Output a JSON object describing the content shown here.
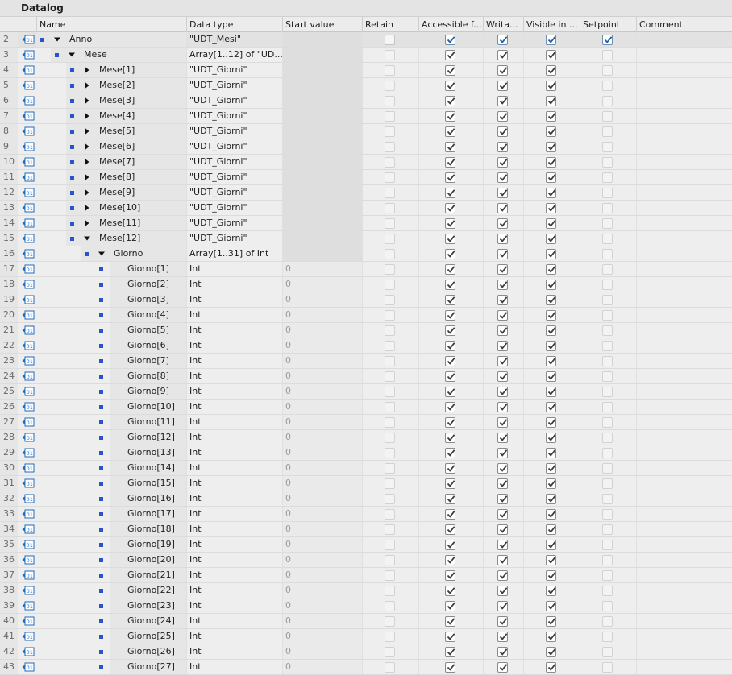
{
  "window": {
    "title": "Datalog"
  },
  "columns": [
    "Name",
    "Data type",
    "Start value",
    "Retain",
    "Accessible f...",
    "Writa...",
    "Visible in ...",
    "Setpoint",
    "Comment"
  ],
  "icons": {
    "row_icon": "db-element-icon",
    "bullet": "blue-square-icon",
    "expanded": "triangle-down-icon",
    "collapsed": "triangle-right-icon"
  },
  "colors": {
    "bullet": "#2b53c8",
    "icon": "#1c6cbf",
    "check_blue": "#1f5fa0"
  },
  "rows": [
    {
      "num": "2",
      "name": "Anno",
      "type": "\"UDT_Mesi\"",
      "start": "",
      "level": 0,
      "toggle": "expanded",
      "checks": [
        0,
        2,
        2,
        2,
        2
      ]
    },
    {
      "num": "3",
      "name": "Mese",
      "type": "Array[1..12] of \"UD...",
      "start": "",
      "level": 1,
      "toggle": "expanded",
      "checks": [
        3,
        1,
        1,
        1,
        3
      ]
    },
    {
      "num": "4",
      "name": "Mese[1]",
      "type": "\"UDT_Giorni\"",
      "start": "",
      "level": 2,
      "toggle": "collapsed",
      "checks": [
        3,
        1,
        1,
        1,
        3
      ]
    },
    {
      "num": "5",
      "name": "Mese[2]",
      "type": "\"UDT_Giorni\"",
      "start": "",
      "level": 2,
      "toggle": "collapsed",
      "checks": [
        3,
        1,
        1,
        1,
        3
      ]
    },
    {
      "num": "6",
      "name": "Mese[3]",
      "type": "\"UDT_Giorni\"",
      "start": "",
      "level": 2,
      "toggle": "collapsed",
      "checks": [
        3,
        1,
        1,
        1,
        3
      ]
    },
    {
      "num": "7",
      "name": "Mese[4]",
      "type": "\"UDT_Giorni\"",
      "start": "",
      "level": 2,
      "toggle": "collapsed",
      "checks": [
        3,
        1,
        1,
        1,
        3
      ]
    },
    {
      "num": "8",
      "name": "Mese[5]",
      "type": "\"UDT_Giorni\"",
      "start": "",
      "level": 2,
      "toggle": "collapsed",
      "checks": [
        3,
        1,
        1,
        1,
        3
      ]
    },
    {
      "num": "9",
      "name": "Mese[6]",
      "type": "\"UDT_Giorni\"",
      "start": "",
      "level": 2,
      "toggle": "collapsed",
      "checks": [
        3,
        1,
        1,
        1,
        3
      ]
    },
    {
      "num": "10",
      "name": "Mese[7]",
      "type": "\"UDT_Giorni\"",
      "start": "",
      "level": 2,
      "toggle": "collapsed",
      "checks": [
        3,
        1,
        1,
        1,
        3
      ]
    },
    {
      "num": "11",
      "name": "Mese[8]",
      "type": "\"UDT_Giorni\"",
      "start": "",
      "level": 2,
      "toggle": "collapsed",
      "checks": [
        3,
        1,
        1,
        1,
        3
      ]
    },
    {
      "num": "12",
      "name": "Mese[9]",
      "type": "\"UDT_Giorni\"",
      "start": "",
      "level": 2,
      "toggle": "collapsed",
      "checks": [
        3,
        1,
        1,
        1,
        3
      ]
    },
    {
      "num": "13",
      "name": "Mese[10]",
      "type": "\"UDT_Giorni\"",
      "start": "",
      "level": 2,
      "toggle": "collapsed",
      "checks": [
        3,
        1,
        1,
        1,
        3
      ]
    },
    {
      "num": "14",
      "name": "Mese[11]",
      "type": "\"UDT_Giorni\"",
      "start": "",
      "level": 2,
      "toggle": "collapsed",
      "checks": [
        3,
        1,
        1,
        1,
        3
      ]
    },
    {
      "num": "15",
      "name": "Mese[12]",
      "type": "\"UDT_Giorni\"",
      "start": "",
      "level": 2,
      "toggle": "expanded",
      "checks": [
        3,
        1,
        1,
        1,
        3
      ]
    },
    {
      "num": "16",
      "name": "Giorno",
      "type": "Array[1..31] of Int",
      "start": "",
      "level": 3,
      "toggle": "expanded",
      "checks": [
        3,
        1,
        1,
        1,
        3
      ]
    },
    {
      "num": "17",
      "name": "Giorno[1]",
      "type": "Int",
      "start": "0",
      "level": 4,
      "toggle": "",
      "checks": [
        3,
        1,
        1,
        1,
        3
      ]
    },
    {
      "num": "18",
      "name": "Giorno[2]",
      "type": "Int",
      "start": "0",
      "level": 4,
      "toggle": "",
      "checks": [
        3,
        1,
        1,
        1,
        3
      ]
    },
    {
      "num": "19",
      "name": "Giorno[3]",
      "type": "Int",
      "start": "0",
      "level": 4,
      "toggle": "",
      "checks": [
        3,
        1,
        1,
        1,
        3
      ]
    },
    {
      "num": "20",
      "name": "Giorno[4]",
      "type": "Int",
      "start": "0",
      "level": 4,
      "toggle": "",
      "checks": [
        3,
        1,
        1,
        1,
        3
      ]
    },
    {
      "num": "21",
      "name": "Giorno[5]",
      "type": "Int",
      "start": "0",
      "level": 4,
      "toggle": "",
      "checks": [
        3,
        1,
        1,
        1,
        3
      ]
    },
    {
      "num": "22",
      "name": "Giorno[6]",
      "type": "Int",
      "start": "0",
      "level": 4,
      "toggle": "",
      "checks": [
        3,
        1,
        1,
        1,
        3
      ]
    },
    {
      "num": "23",
      "name": "Giorno[7]",
      "type": "Int",
      "start": "0",
      "level": 4,
      "toggle": "",
      "checks": [
        3,
        1,
        1,
        1,
        3
      ]
    },
    {
      "num": "24",
      "name": "Giorno[8]",
      "type": "Int",
      "start": "0",
      "level": 4,
      "toggle": "",
      "checks": [
        3,
        1,
        1,
        1,
        3
      ]
    },
    {
      "num": "25",
      "name": "Giorno[9]",
      "type": "Int",
      "start": "0",
      "level": 4,
      "toggle": "",
      "checks": [
        3,
        1,
        1,
        1,
        3
      ]
    },
    {
      "num": "26",
      "name": "Giorno[10]",
      "type": "Int",
      "start": "0",
      "level": 4,
      "toggle": "",
      "checks": [
        3,
        1,
        1,
        1,
        3
      ]
    },
    {
      "num": "27",
      "name": "Giorno[11]",
      "type": "Int",
      "start": "0",
      "level": 4,
      "toggle": "",
      "checks": [
        3,
        1,
        1,
        1,
        3
      ]
    },
    {
      "num": "28",
      "name": "Giorno[12]",
      "type": "Int",
      "start": "0",
      "level": 4,
      "toggle": "",
      "checks": [
        3,
        1,
        1,
        1,
        3
      ]
    },
    {
      "num": "29",
      "name": "Giorno[13]",
      "type": "Int",
      "start": "0",
      "level": 4,
      "toggle": "",
      "checks": [
        3,
        1,
        1,
        1,
        3
      ]
    },
    {
      "num": "30",
      "name": "Giorno[14]",
      "type": "Int",
      "start": "0",
      "level": 4,
      "toggle": "",
      "checks": [
        3,
        1,
        1,
        1,
        3
      ]
    },
    {
      "num": "31",
      "name": "Giorno[15]",
      "type": "Int",
      "start": "0",
      "level": 4,
      "toggle": "",
      "checks": [
        3,
        1,
        1,
        1,
        3
      ]
    },
    {
      "num": "32",
      "name": "Giorno[16]",
      "type": "Int",
      "start": "0",
      "level": 4,
      "toggle": "",
      "checks": [
        3,
        1,
        1,
        1,
        3
      ]
    },
    {
      "num": "33",
      "name": "Giorno[17]",
      "type": "Int",
      "start": "0",
      "level": 4,
      "toggle": "",
      "checks": [
        3,
        1,
        1,
        1,
        3
      ]
    },
    {
      "num": "34",
      "name": "Giorno[18]",
      "type": "Int",
      "start": "0",
      "level": 4,
      "toggle": "",
      "checks": [
        3,
        1,
        1,
        1,
        3
      ]
    },
    {
      "num": "35",
      "name": "Giorno[19]",
      "type": "Int",
      "start": "0",
      "level": 4,
      "toggle": "",
      "checks": [
        3,
        1,
        1,
        1,
        3
      ]
    },
    {
      "num": "36",
      "name": "Giorno[20]",
      "type": "Int",
      "start": "0",
      "level": 4,
      "toggle": "",
      "checks": [
        3,
        1,
        1,
        1,
        3
      ]
    },
    {
      "num": "37",
      "name": "Giorno[21]",
      "type": "Int",
      "start": "0",
      "level": 4,
      "toggle": "",
      "checks": [
        3,
        1,
        1,
        1,
        3
      ]
    },
    {
      "num": "38",
      "name": "Giorno[22]",
      "type": "Int",
      "start": "0",
      "level": 4,
      "toggle": "",
      "checks": [
        3,
        1,
        1,
        1,
        3
      ]
    },
    {
      "num": "39",
      "name": "Giorno[23]",
      "type": "Int",
      "start": "0",
      "level": 4,
      "toggle": "",
      "checks": [
        3,
        1,
        1,
        1,
        3
      ]
    },
    {
      "num": "40",
      "name": "Giorno[24]",
      "type": "Int",
      "start": "0",
      "level": 4,
      "toggle": "",
      "checks": [
        3,
        1,
        1,
        1,
        3
      ]
    },
    {
      "num": "41",
      "name": "Giorno[25]",
      "type": "Int",
      "start": "0",
      "level": 4,
      "toggle": "",
      "checks": [
        3,
        1,
        1,
        1,
        3
      ]
    },
    {
      "num": "42",
      "name": "Giorno[26]",
      "type": "Int",
      "start": "0",
      "level": 4,
      "toggle": "",
      "checks": [
        3,
        1,
        1,
        1,
        3
      ]
    },
    {
      "num": "43",
      "name": "Giorno[27]",
      "type": "Int",
      "start": "0",
      "level": 4,
      "toggle": "",
      "checks": [
        3,
        1,
        1,
        1,
        3
      ]
    }
  ]
}
